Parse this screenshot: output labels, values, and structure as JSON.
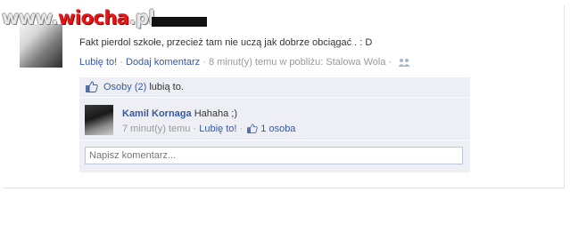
{
  "watermark": {
    "prefix": "www.",
    "accent": "wiocha",
    "suffix": ".pl"
  },
  "post": {
    "text": "Fakt pierdol szkołe, przecież tam nie uczą jak dobrze obciągać . : D",
    "like_label": "Lubię to!",
    "comment_label": "Dodaj komentarz",
    "time_location": "8 minut(y) temu w pobliżu: Stalowa Wola",
    "separator": "·"
  },
  "likes": {
    "count_link": "Osoby (2)",
    "suffix": "lubią to."
  },
  "comment": {
    "author": "Kamil Kornaga",
    "text": "Hahaha ;)",
    "time": "7 minut(y) temu",
    "like_label": "Lubię to!",
    "like_count": "1 osoba",
    "separator": "·"
  },
  "comment_input": {
    "placeholder": "Napisz komentarz..."
  },
  "colors": {
    "link": "#3b5998",
    "box_bg": "#edeff4",
    "meta_gray": "#999999",
    "input_border": "#bdc7d8"
  }
}
